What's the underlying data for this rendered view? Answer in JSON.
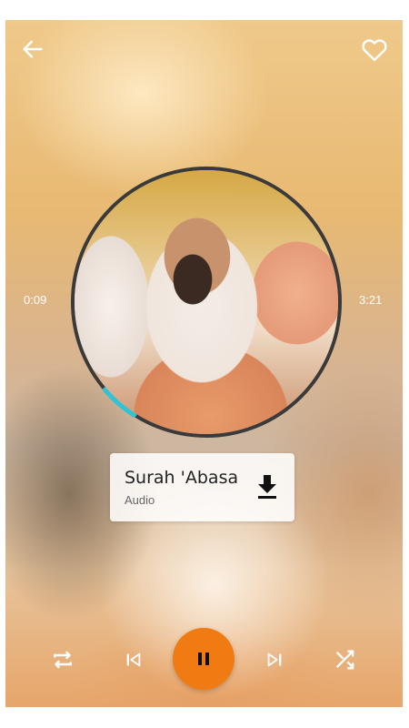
{
  "header": {
    "back_icon": "arrow-left-icon",
    "favorite_icon": "heart-outline-icon"
  },
  "playback": {
    "current_time": "0:09",
    "total_time": "3:21",
    "progress": 0.045
  },
  "track": {
    "title": "Surah 'Abasa",
    "subtitle": "Audio",
    "download_icon": "download-icon"
  },
  "controls": {
    "repeat_icon": "repeat-icon",
    "previous_icon": "skip-previous-icon",
    "play_pause_icon": "pause-icon",
    "next_icon": "skip-next-icon",
    "shuffle_icon": "shuffle-icon"
  },
  "colors": {
    "accent": "#f07b12",
    "progress": "#2ec4d6",
    "ring": "#3a3a3a",
    "icon": "#ffffff"
  }
}
